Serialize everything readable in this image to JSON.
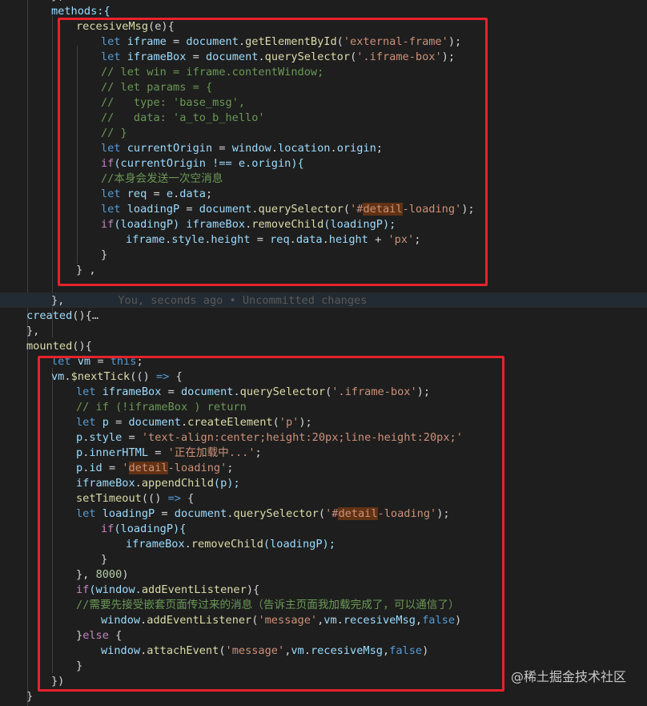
{
  "code": {
    "l0": "methods:{",
    "l1a": "recesiveMsg",
    "l1b": "(e){",
    "l2": [
      "let",
      "iframe",
      "=",
      "document",
      "getElementById",
      "'external-frame'",
      ");"
    ],
    "l3": [
      "let",
      "iframeBox",
      "=",
      "document",
      "querySelector",
      "'.iframe-box'",
      ");"
    ],
    "l4": "// let win = iframe.contentWindow;",
    "l5": "// let params = {",
    "l6": "//   type: 'base_msg',",
    "l7": "//   data: 'a_to_b_hello'",
    "l8": "// }",
    "l9": [
      "let",
      "currentOrigin",
      "=",
      "window",
      "location",
      "origin",
      ";"
    ],
    "l10": [
      "if",
      "(currentOrigin !== e.origin){"
    ],
    "l11": "//本身会发送一次空消息",
    "l12": [
      "let",
      "req",
      "=",
      "e",
      "data",
      ";"
    ],
    "l13": [
      "let",
      "loadingP",
      "=",
      "document",
      "querySelector",
      "'#",
      "detail",
      "-loading'",
      ");"
    ],
    "l14": [
      "if",
      "(loadingP) ",
      "iframeBox",
      "removeChild",
      "(loadingP);"
    ],
    "l15": [
      "iframe",
      "style",
      "height",
      "=",
      "req",
      "data",
      "height",
      "+",
      "'px'",
      ";"
    ],
    "l16": "}",
    "l17": "} ,",
    "l18": "},",
    "blame": "You, seconds ago • Uncommitted changes",
    "l19a": "created",
    "l19b": "(){",
    "l19c": "…",
    "l20": "},",
    "l21a": "mounted",
    "l21b": "(){",
    "l22": [
      "let",
      "vm",
      "=",
      "this",
      ";"
    ],
    "l23": [
      "vm",
      "$nextTick",
      "(() ",
      "=>",
      " {"
    ],
    "l24": [
      "let",
      "iframeBox",
      "=",
      "document",
      "querySelector",
      "'.iframe-box'",
      ");"
    ],
    "l25": "// if (!iframeBox ) return",
    "l26": [
      "let",
      "p",
      "=",
      "document",
      "createElement",
      "'p'",
      ");"
    ],
    "l27": [
      "p",
      "style",
      "=",
      "'text-align:center;height:20px;line-height:20px;'"
    ],
    "l28": [
      "p",
      "innerHTML",
      "=",
      "'正在加载中...'",
      ";"
    ],
    "l29": [
      "p",
      "id",
      "=",
      "'",
      "detail",
      "-loading'",
      ";"
    ],
    "l30": [
      "iframeBox",
      "appendChild",
      "(p);"
    ],
    "l31": [
      "setTimeout",
      "(() ",
      "=>",
      " {"
    ],
    "l32": [
      "let",
      "loadingP",
      "=",
      "document",
      "querySelector",
      "'#",
      "detail",
      "-loading'",
      ");"
    ],
    "l33": [
      "if",
      "(loadingP){"
    ],
    "l34": [
      "iframeBox",
      "removeChild",
      "(loadingP);"
    ],
    "l35": "}",
    "l36": [
      "}, ",
      "8000",
      ")"
    ],
    "l37": [
      "if",
      "(window.",
      "addEventListener",
      "){"
    ],
    "l38": "//需要先接受嵌套页面传过来的消息（告诉主页面我加载完成了，可以通信了）",
    "l39": [
      "window",
      "addEventListener",
      "'message'",
      "vm",
      "recesiveMsg",
      "false",
      ")"
    ],
    "l40": [
      "}",
      "else",
      " {"
    ],
    "l41": [
      "window",
      "attachEvent",
      "'message'",
      "vm",
      "recesiveMsg",
      "false",
      ")"
    ],
    "l42": "}",
    "l43": "})",
    "l44": "}"
  },
  "watermark": "@稀土掘金技术社区",
  "colors": {
    "highlight_box": "#e8222b",
    "background": "#1e1e1e"
  }
}
